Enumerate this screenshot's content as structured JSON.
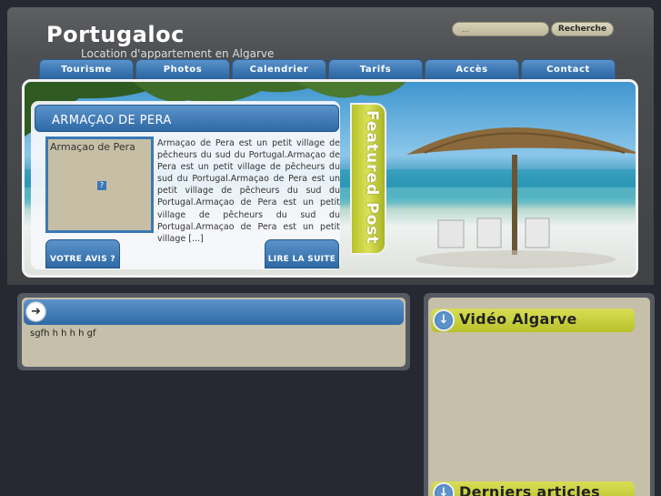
{
  "header": {
    "title": "Portugaloc",
    "tagline": "Location d'appartement en Algarve"
  },
  "search": {
    "value": "...",
    "button_label": "Recherche"
  },
  "nav": {
    "items": [
      {
        "label": "Tourisme"
      },
      {
        "label": "Photos"
      },
      {
        "label": "Calendrier"
      },
      {
        "label": "Tarifs"
      },
      {
        "label": "Accès"
      },
      {
        "label": "Contact"
      }
    ]
  },
  "featured": {
    "title": "ARMAÇAO DE PERA",
    "image_alt": "Armaçao de Pera",
    "broken_image_glyph": "?",
    "excerpt": "Armaçao de Pera est un petit village de pêcheurs du sud du Portugal.Armaçao de Pera est un petit village de pêcheurs du sud du Portugal.Armaçao de Pera est un petit village de pêcheurs du sud du Portugal.Armaçao de Pera est un petit village de pêcheurs du sud du Portugal.Armaçao de Pera est un petit village [...]",
    "review_button": "VOTRE AVIS ?",
    "read_more_button": "LIRE LA SUITE",
    "ribbon": "Featured Post"
  },
  "content": {
    "icon": "arrow-right-icon",
    "text": "sgfh h h h  h gf"
  },
  "sidebar": {
    "widgets": [
      {
        "title": "Vidéo Algarve",
        "icon": "arrow-down-icon"
      },
      {
        "title": "Derniers articles",
        "icon": "arrow-down-icon"
      }
    ]
  },
  "colors": {
    "page_bg": "#262931",
    "nav_blue": "#3b78b5",
    "widget_yellow": "#c8d03c",
    "panel_beige": "#c6bfa9"
  }
}
